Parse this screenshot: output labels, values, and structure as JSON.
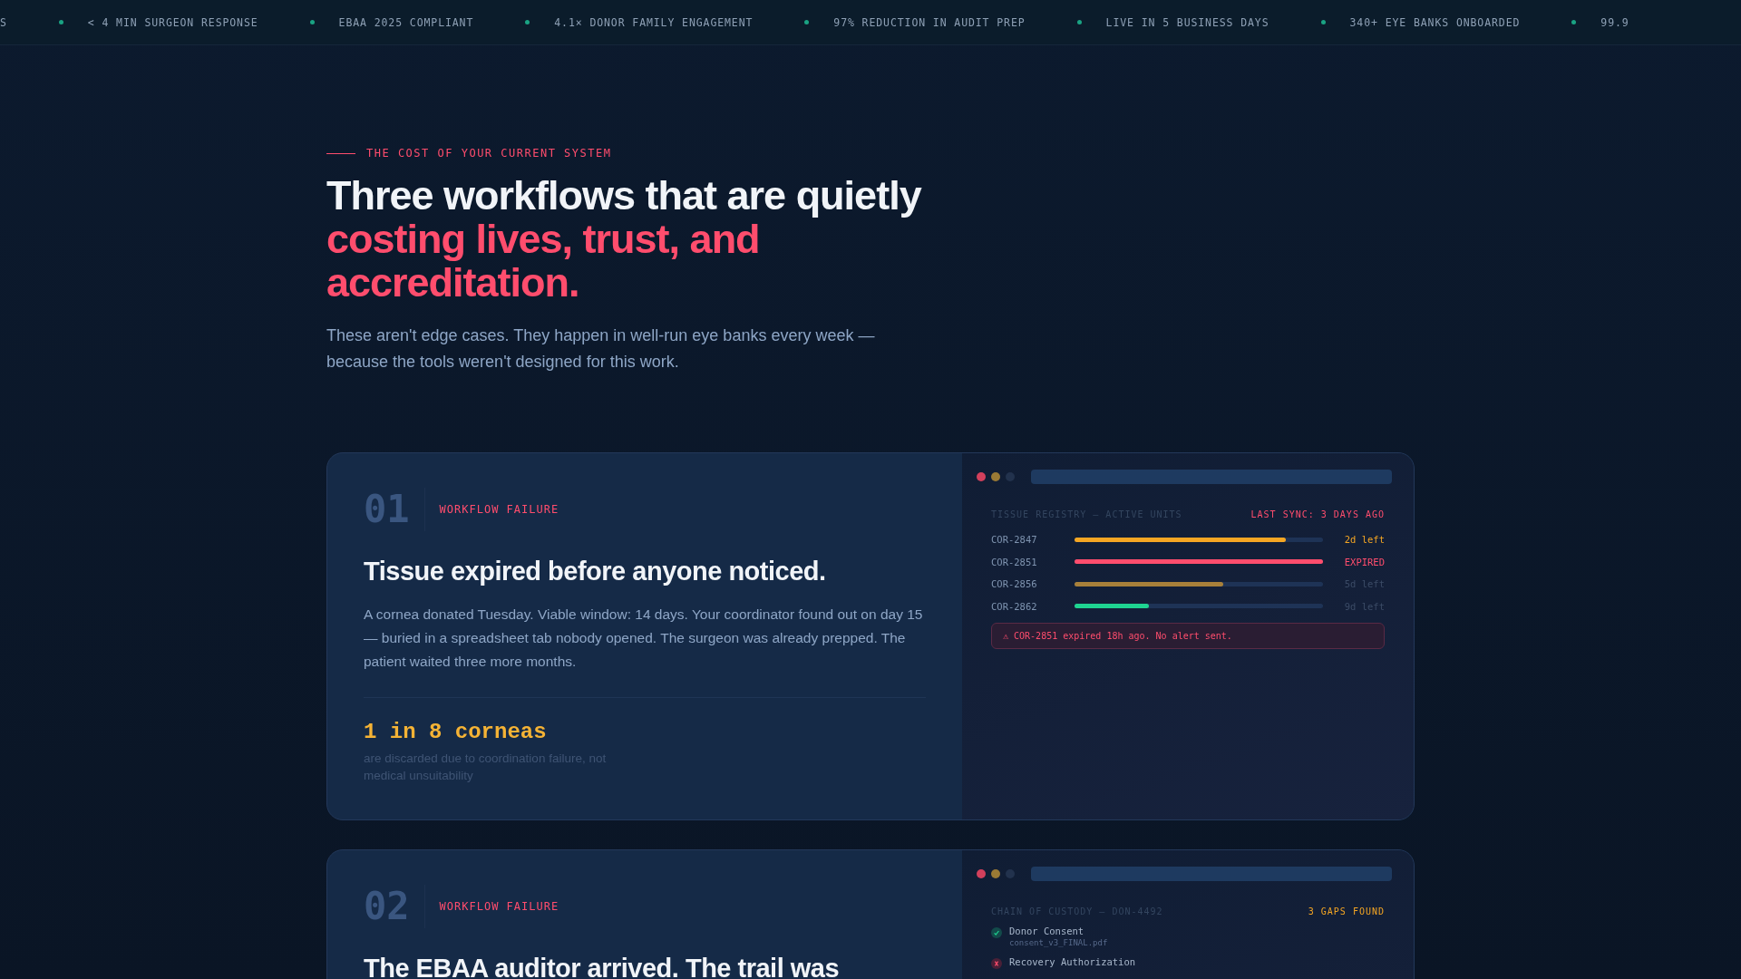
{
  "ticker": [
    "S",
    "< 4 MIN SURGEON RESPONSE",
    "EBAA 2025 COMPLIANT",
    "4.1× DONOR FAMILY ENGAGEMENT",
    "97% REDUCTION IN AUDIT PREP",
    "LIVE IN 5 BUSINESS DAYS",
    "340+ EYE BANKS ONBOARDED",
    "99.9"
  ],
  "section": {
    "eyebrow": "THE COST OF YOUR CURRENT SYSTEM",
    "headline": "Three workflows that are quietly ",
    "headline_accent": "costing lives, trust, and accreditation.",
    "intro": "These aren't edge cases. They happen in well-run eye banks every week — because the tools weren't designed for this work."
  },
  "cards": [
    {
      "number": "01",
      "tag": "WORKFLOW FAILURE",
      "title": "Tissue expired before anyone noticed.",
      "body": "A cornea donated Tuesday. Viable window: 14 days. Your coordinator found out on day 15 — buried in a spreadsheet tab nobody opened. The surgeon was already prepped. The patient waited three more months.",
      "stat": "1 in 8 corneas",
      "stat_note": "are discarded due to coordination failure, not medical unsuitability",
      "panel": {
        "kind": "registry",
        "title": "TISSUE REGISTRY — ACTIVE UNITS",
        "flag": "LAST SYNC: 3 DAYS AGO",
        "rows": [
          {
            "id": "COR-2847",
            "level": 0.85,
            "color": "#f5a623",
            "kind": "warning",
            "reading": "2d left"
          },
          {
            "id": "COR-2851",
            "level": 1,
            "color": "#ff4d6d",
            "kind": "expired",
            "reading": "EXPIRED"
          },
          {
            "id": "COR-2856",
            "level": 0.6,
            "color": "#a8803a",
            "kind": "muted",
            "reading": "5d left"
          },
          {
            "id": "COR-2862",
            "level": 0.3,
            "color": "#1ed491",
            "kind": "muted",
            "reading": "9d left"
          }
        ],
        "alert": "⚠ COR-2851 expired 18h ago. No alert sent."
      }
    },
    {
      "number": "02",
      "tag": "WORKFLOW FAILURE",
      "title": "The EBAA auditor arrived. The trail was",
      "panel": {
        "kind": "custody",
        "title": "CHAIN OF CUSTODY — DON-4492",
        "flag": "3 GAPS FOUND",
        "items": [
          {
            "name": "Donor Consent",
            "ok": true,
            "file": "consent_v3_FINAL.pdf"
          },
          {
            "name": "Recovery Authorization",
            "ok": false
          }
        ]
      }
    }
  ]
}
